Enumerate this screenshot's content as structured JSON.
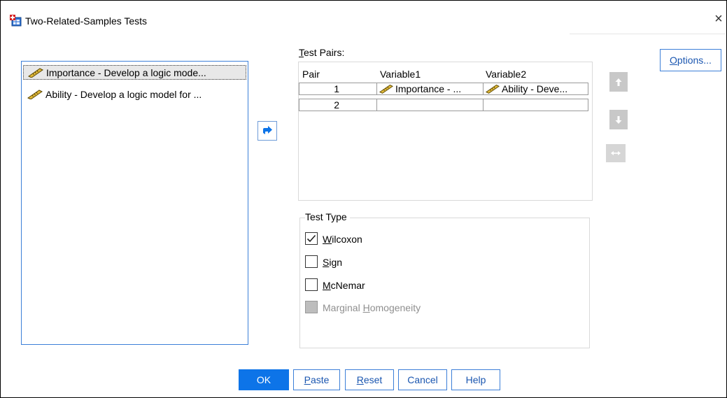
{
  "window": {
    "title": "Two-Related-Samples Tests",
    "close_label": "×"
  },
  "source_list": {
    "items": [
      {
        "label": "Importance - Develop a logic mode...",
        "selected": true
      },
      {
        "label": "Ability - Develop a logic model for ...",
        "selected": false
      }
    ]
  },
  "test_pairs": {
    "label_prefix": "",
    "label_mnemonic": "T",
    "label_rest": "est Pairs:",
    "headers": [
      "Pair",
      "Variable1",
      "Variable2"
    ],
    "rows": [
      {
        "pair": "1",
        "var1": "Importance - ...",
        "var2": "Ability - Deve..."
      },
      {
        "pair": "2",
        "var1": "",
        "var2": ""
      }
    ]
  },
  "options_button": {
    "mnemonic": "O",
    "rest": "ptions..."
  },
  "test_type": {
    "legend": "Test Type",
    "options": [
      {
        "pre": "",
        "mn": "W",
        "post": "ilcoxon",
        "checked": true,
        "disabled": false
      },
      {
        "pre": "",
        "mn": "S",
        "post": "ign",
        "checked": false,
        "disabled": false
      },
      {
        "pre": "",
        "mn": "M",
        "post": "cNemar",
        "checked": false,
        "disabled": false
      },
      {
        "pre": "Marginal ",
        "mn": "H",
        "post": "omogeneity",
        "checked": false,
        "disabled": true
      }
    ]
  },
  "buttons": {
    "ok": "OK",
    "paste": {
      "mn": "P",
      "rest": "aste"
    },
    "reset": {
      "mn": "R",
      "rest": "eset"
    },
    "cancel": "Cancel",
    "help": "Help"
  },
  "colors": {
    "accent": "#0d74e8",
    "focus_border": "#3c7fd8",
    "disabled_btn": "#c8c8c8"
  },
  "icons": {
    "app": "spss-app-icon",
    "ruler": "scale-variable-icon",
    "move": "arrow-right-icon",
    "up": "arrow-up-icon",
    "down": "arrow-down-icon",
    "swap": "swap-horizontal-icon",
    "check": "checkmark-icon",
    "close": "close-icon"
  }
}
